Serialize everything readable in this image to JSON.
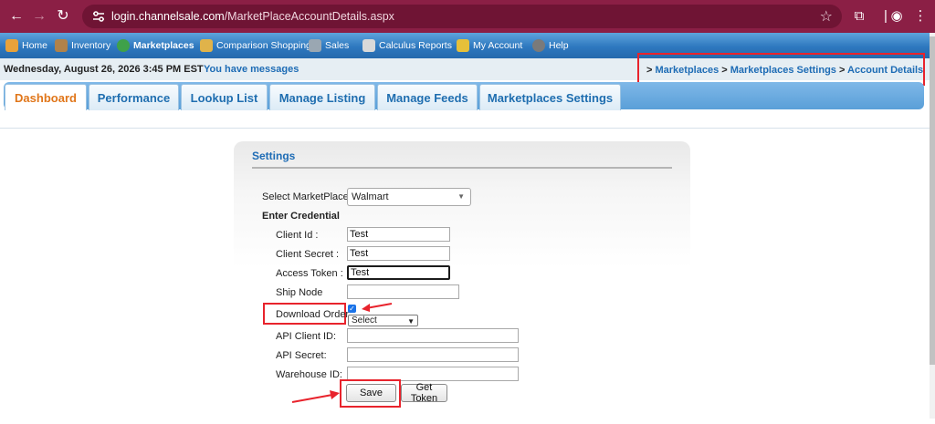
{
  "browser": {
    "url_host": "login.channelsale.com",
    "url_path": "/MarketPlaceAccountDetails.aspx"
  },
  "menu": {
    "items": [
      {
        "label": "Home",
        "icon": "home-icon",
        "color": "#e8a23a"
      },
      {
        "label": "Inventory",
        "icon": "inventory-icon",
        "color": "#b0824a"
      },
      {
        "label": "Marketplaces",
        "icon": "globe-icon",
        "color": "#3fa14a"
      },
      {
        "label": "Comparison Shopping",
        "icon": "shopping-icon",
        "color": "#e0b34a"
      },
      {
        "label": "Sales",
        "icon": "sales-icon",
        "color": "#9aa7b2"
      },
      {
        "label": "Calculus Reports",
        "icon": "chart-icon",
        "color": "#d9d9d9"
      },
      {
        "label": "My Account",
        "icon": "account-icon",
        "color": "#e6c03a"
      },
      {
        "label": "Help",
        "icon": "help-icon",
        "color": "#7a7a7a"
      }
    ]
  },
  "header": {
    "date": "Wednesday, August 26, 2026 3:45 PM EST",
    "messages_link": "You have messages",
    "breadcrumb": {
      "sep1": "> ",
      "item1": "Marketplaces",
      "sep2": " > ",
      "item2": "Marketplaces Settings",
      "sep3": " > ",
      "item3": "Account Details"
    }
  },
  "tabs": [
    {
      "label": "Dashboard",
      "active": true
    },
    {
      "label": "Performance",
      "active": false
    },
    {
      "label": "Lookup List",
      "active": false
    },
    {
      "label": "Manage Listing",
      "active": false
    },
    {
      "label": "Manage Feeds",
      "active": false
    },
    {
      "label": "Marketplaces Settings",
      "active": false
    }
  ],
  "settings": {
    "title": "Settings",
    "select_marketplace_label": "Select MarketPlace:",
    "select_marketplace_value": "Walmart",
    "enter_credential_label": "Enter Credential",
    "client_id_label": "Client Id :",
    "client_id_value": "Test",
    "client_secret_label": "Client Secret :",
    "client_secret_value": "Test",
    "access_token_label": "Access Token :",
    "access_token_value": "Test",
    "ship_node_label": "Ship Node",
    "ship_node_value": "",
    "download_order_label": "Download Order:",
    "download_order_checked": true,
    "download_order_select": "Select",
    "api_client_id_label": "API Client ID:",
    "api_client_id_value": "",
    "api_secret_label": "API Secret:",
    "api_secret_value": "",
    "warehouse_id_label": "Warehouse ID:",
    "warehouse_id_value": "",
    "save_button": "Save",
    "get_token_button": "Get Token"
  },
  "colors": {
    "chrome": "#8b1f45",
    "menubar": "#2e78bf",
    "link": "#1e6cb5",
    "active_tab": "#e0761a",
    "annotation": "#e8232c"
  }
}
